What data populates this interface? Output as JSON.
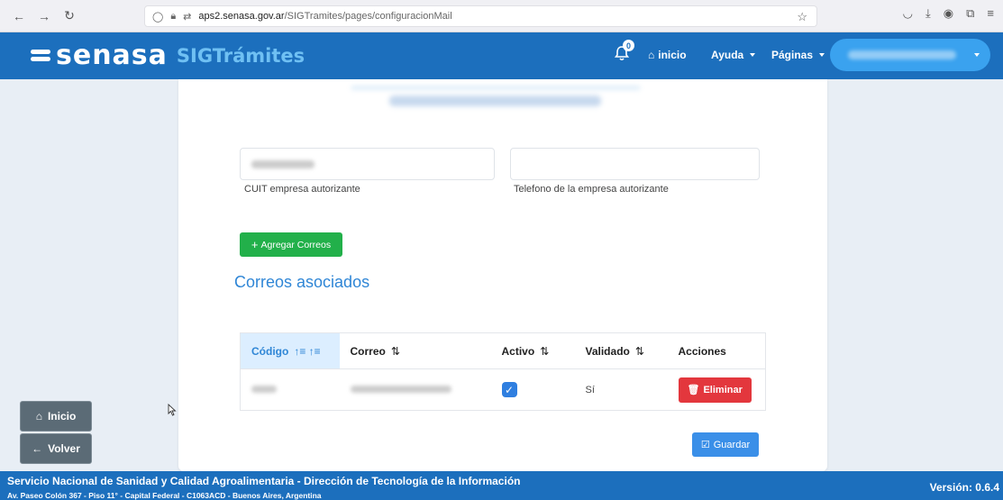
{
  "browser": {
    "url_host": "aps2.senasa.gov.ar",
    "url_path": "/SIGTramites/pages/configuracionMail"
  },
  "header": {
    "brand": "senasa",
    "app_name": "SIGTrámites",
    "notification_count": "0",
    "nav": {
      "inicio": "inicio",
      "ayuda": "Ayuda",
      "paginas": "Páginas"
    }
  },
  "form": {
    "cuit_label": "CUIT empresa autorizante",
    "telefono_label": "Telefono de la empresa autorizante",
    "telefono_value": "",
    "add_button": "Agregar Correos"
  },
  "section": {
    "title": "Correos asociados"
  },
  "table": {
    "columns": [
      "Código",
      "Correo",
      "Activo",
      "Validado",
      "Acciones"
    ],
    "rows": [
      {
        "validado": "Sí",
        "activo": true,
        "action": "Eliminar"
      }
    ]
  },
  "save_button": "Guardar",
  "side": {
    "inicio": "Inicio",
    "volver": "Volver"
  },
  "footer": {
    "main": "Servicio Nacional de Sanidad y Calidad Agroalimentaria - Dirección de Tecnología de la Información",
    "address": "Av. Paseo Colón 367 - Piso 11° - Capital Federal - C1063ACD - Buenos Aires, Argentina",
    "version": "Versión: 0.6.4"
  },
  "colors": {
    "brand_blue": "#1c6fbd",
    "success": "#22b04a",
    "danger": "#e3373d",
    "primary": "#3a8fe8"
  }
}
